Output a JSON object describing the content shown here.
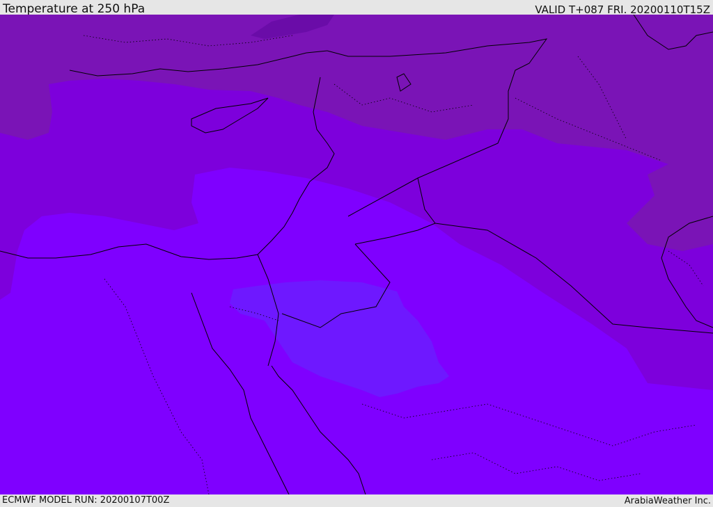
{
  "header": {
    "title": "Temperature at 250 hPa",
    "valid": "VALID T+087 FRI. 20200110T15Z"
  },
  "footer": {
    "model_run": "ECMWF MODEL RUN: 20200107T00Z",
    "credit": "ArabiaWeather Inc."
  },
  "map": {
    "field": "temperature",
    "level": "250 hPa",
    "colors": {
      "coldest_band": "#6a0ca8",
      "band_north": "#7a14b6",
      "band_mid": "#7d00dc",
      "band_main": "#7f00ff",
      "band_warm_patch": "#6e18ff",
      "boundaries": "#000000"
    }
  }
}
